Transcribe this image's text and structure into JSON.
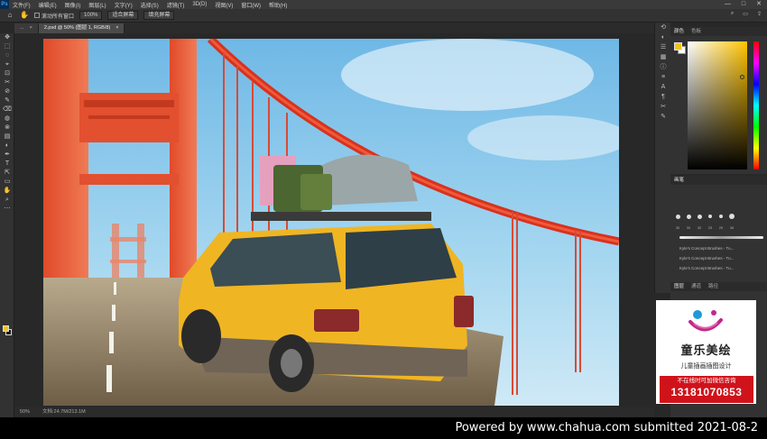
{
  "menubar": {
    "logo": "Ps",
    "items": [
      "文件(F)",
      "编辑(E)",
      "图像(I)",
      "图层(L)",
      "文字(Y)",
      "选择(S)",
      "滤镜(T)",
      "3D(D)",
      "视图(V)",
      "窗口(W)",
      "帮助(H)"
    ],
    "controls": [
      "—",
      "□",
      "✕"
    ]
  },
  "options": {
    "home_icon": "home-icon",
    "hand_icon": "hand-icon",
    "checkbox_label": "滚动所有窗口",
    "btn_100": "100%",
    "btn_fit": "适合屏幕",
    "btn_fill": "填充屏幕"
  },
  "tabs": [
    {
      "label": "...",
      "active": false
    },
    {
      "label": "2.psd @ 50% (图层 1, RGB/8)",
      "active": true
    }
  ],
  "toolbar": {
    "tools": [
      "✥",
      "⬚",
      "◌",
      "⌖",
      "⊡",
      "✂",
      "⊘",
      "✎",
      "⌫",
      "◍",
      "⊗",
      "▤",
      "◐",
      "✒",
      "T",
      "⇱",
      "▭",
      "✋",
      "⌕",
      "⋯"
    ]
  },
  "status": {
    "zoom": "50%",
    "info": "文档:24.7M/213.1M"
  },
  "panels": {
    "color_tabs": [
      "颜色",
      "色板"
    ],
    "brush_tabs": [
      "画笔"
    ],
    "brush_sizes": [
      "30",
      "30",
      "30",
      "25",
      "25",
      "36"
    ],
    "brushes": [
      "Kyle's Concept Brushes - Tu...",
      "Kyle's Concept Brushes - Tu...",
      "Kyle's Concept Brushes - Tu..."
    ],
    "layers_tabs": [
      "图层",
      "通道",
      "路径"
    ]
  },
  "ad": {
    "title": "童乐美绘",
    "subtitle": "儿童插画插图设计",
    "promo": "不在线时可加微信咨询",
    "phone": "13181070853"
  },
  "footer": {
    "text": "Powered by www.chahua.com submitted 2021-08-2"
  },
  "colors": {
    "foreground": "#f0c419",
    "background": "#ffffff",
    "accent": "#31a8ff"
  }
}
